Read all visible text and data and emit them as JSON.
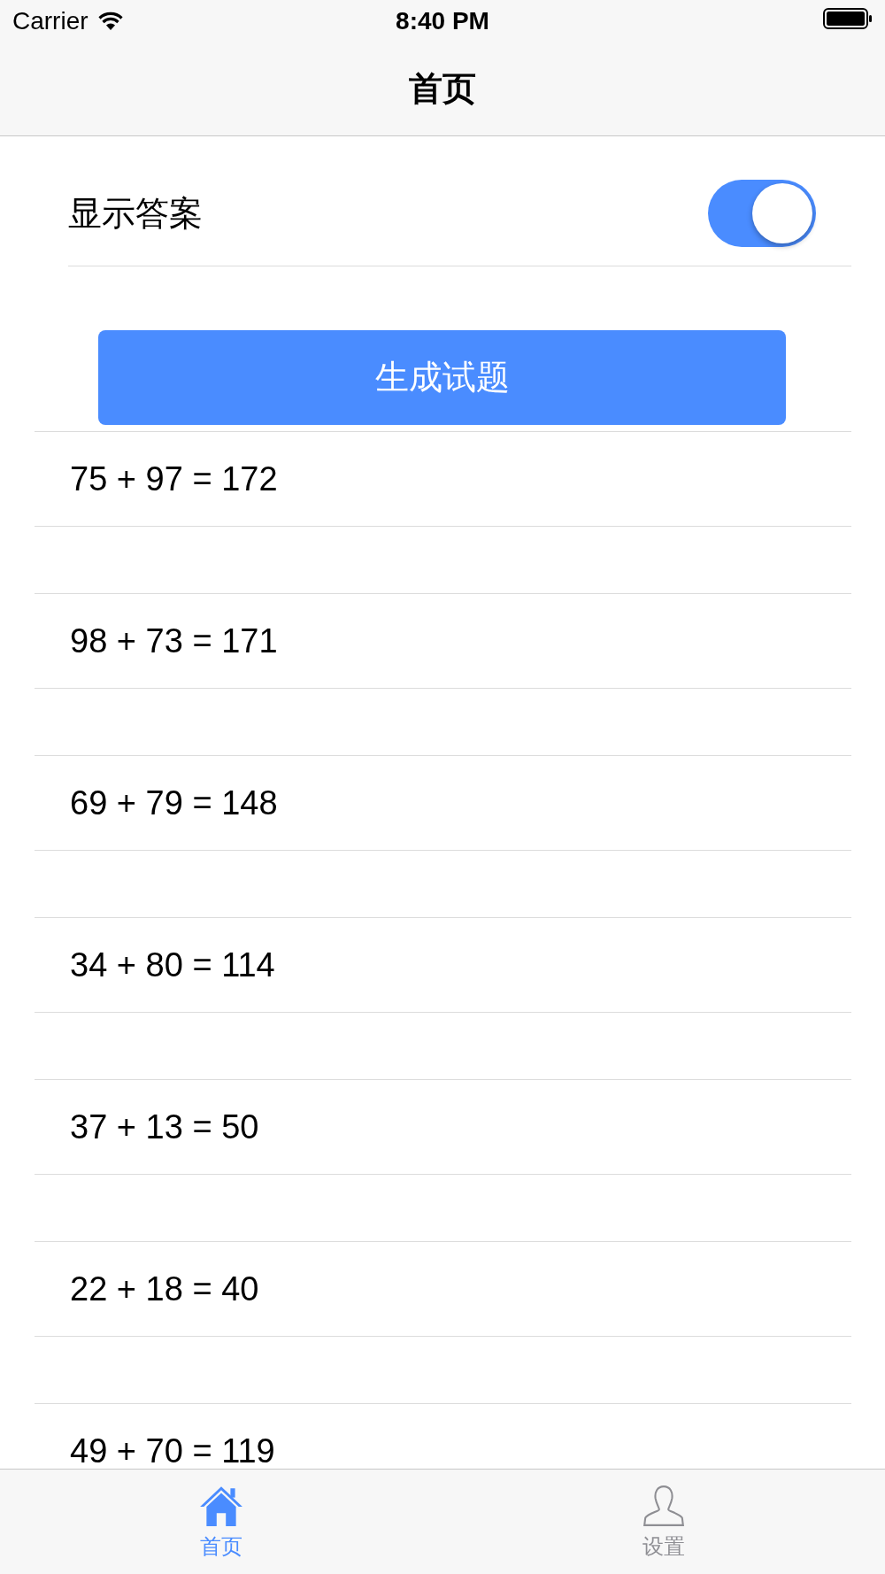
{
  "status_bar": {
    "carrier": "Carrier",
    "time": "8:40 PM"
  },
  "nav": {
    "title": "首页"
  },
  "toggle": {
    "label": "显示答案",
    "on": true
  },
  "button": {
    "label": "生成试题"
  },
  "problems": [
    "75 + 97 = 172",
    "98 + 73 = 171",
    "69 + 79 = 148",
    "34 + 80 = 114",
    "37 + 13 = 50",
    "22 + 18 = 40",
    "49 + 70 = 119"
  ],
  "tab_bar": [
    {
      "kind": "home",
      "label": "首页",
      "selected": true
    },
    {
      "kind": "person",
      "label": "设置",
      "selected": false
    }
  ]
}
